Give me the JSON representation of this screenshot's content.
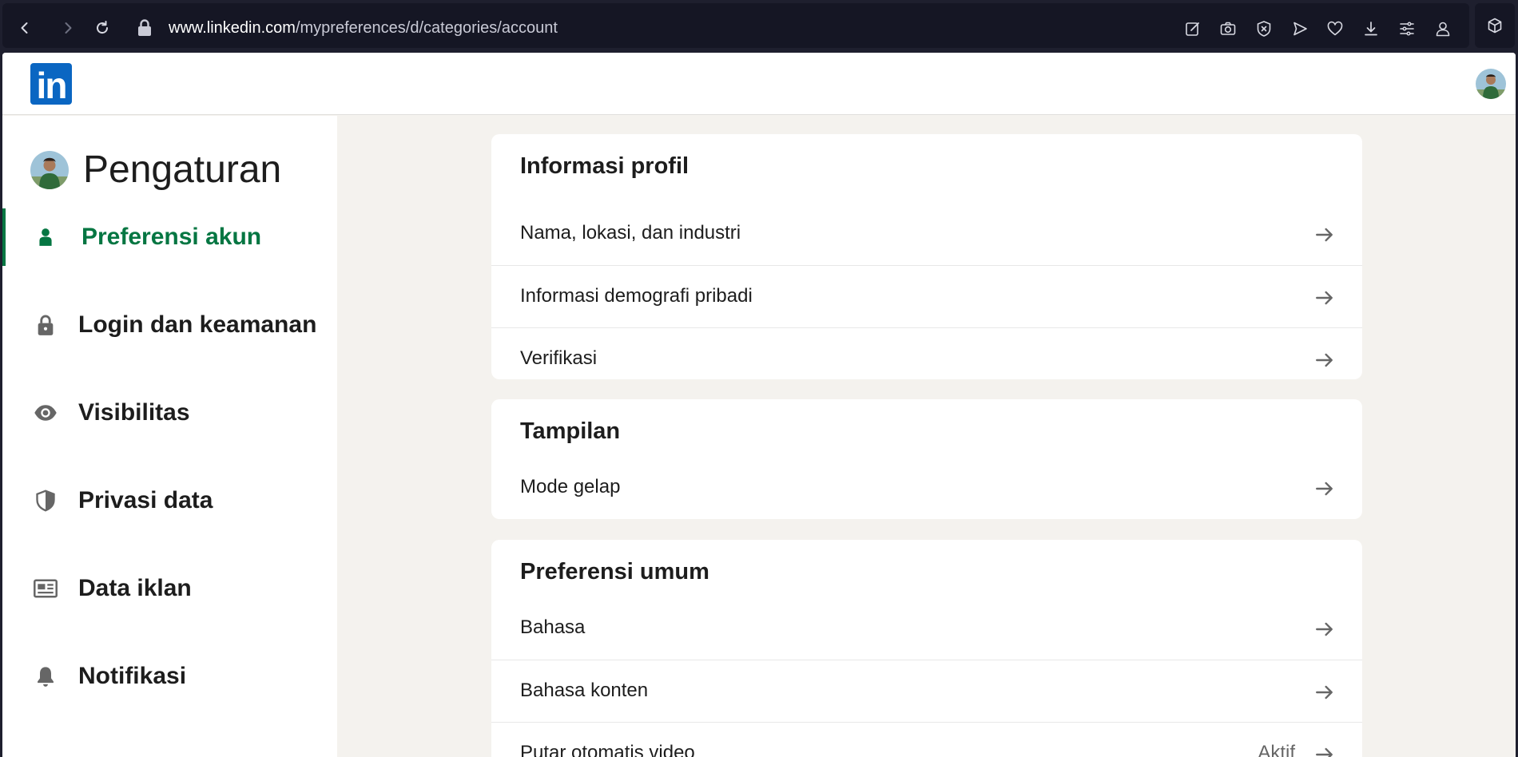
{
  "browser": {
    "url_host": "www.linkedin.com",
    "url_path": "/mypreferences/d/categories/account"
  },
  "settings": {
    "title": "Pengaturan"
  },
  "sidebar": {
    "items": [
      {
        "label": "Preferensi akun",
        "icon": "person-icon",
        "active": true
      },
      {
        "label": "Login dan keamanan",
        "icon": "lock-icon"
      },
      {
        "label": "Visibilitas",
        "icon": "eye-icon"
      },
      {
        "label": "Privasi data",
        "icon": "shield-icon"
      },
      {
        "label": "Data iklan",
        "icon": "ad-data-icon"
      },
      {
        "label": "Notifikasi",
        "icon": "bell-icon"
      }
    ]
  },
  "sections": [
    {
      "title": "Informasi profil",
      "rows": [
        {
          "label": "Nama, lokasi, dan industri"
        },
        {
          "label": "Informasi demografi pribadi"
        },
        {
          "label": "Verifikasi"
        }
      ]
    },
    {
      "title": "Tampilan",
      "rows": [
        {
          "label": "Mode gelap"
        }
      ]
    },
    {
      "title": "Preferensi umum",
      "rows": [
        {
          "label": "Bahasa"
        },
        {
          "label": "Bahasa konten"
        },
        {
          "label": "Putar otomatis video",
          "value": "Aktif"
        }
      ]
    }
  ],
  "colors": {
    "accent_green": "#057642",
    "linkedin_blue": "#0a66c2",
    "page_bg": "#f4f2ee",
    "browser_bg": "#1e1f2e"
  }
}
